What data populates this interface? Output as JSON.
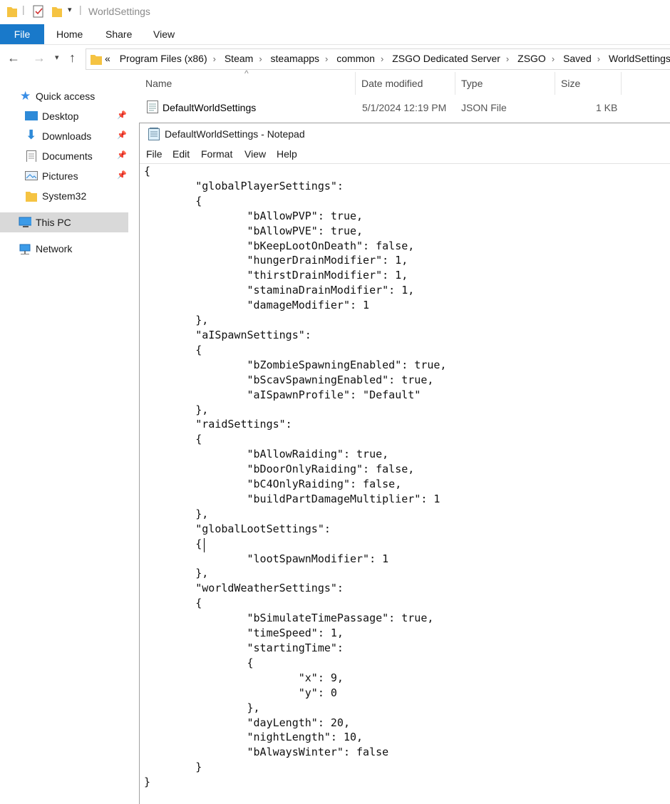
{
  "window": {
    "title": "WorldSettings"
  },
  "ribbon": {
    "tabs": [
      "File",
      "Home",
      "Share",
      "View"
    ]
  },
  "address": {
    "overflow": "«",
    "crumbs": [
      "Program Files (x86)",
      "Steam",
      "steamapps",
      "common",
      "ZSGO Dedicated Server",
      "ZSGO",
      "Saved",
      "WorldSettings"
    ]
  },
  "nav": {
    "items": [
      {
        "label": "Quick access",
        "icon": "star-icon"
      },
      {
        "label": "Desktop",
        "icon": "desktop-icon",
        "pinned": true
      },
      {
        "label": "Downloads",
        "icon": "download-icon",
        "pinned": true
      },
      {
        "label": "Documents",
        "icon": "document-icon",
        "pinned": true
      },
      {
        "label": "Pictures",
        "icon": "picture-icon",
        "pinned": true
      },
      {
        "label": "System32",
        "icon": "folder-icon"
      },
      {
        "label": "This PC",
        "icon": "computer-icon"
      },
      {
        "label": "Network",
        "icon": "network-icon"
      }
    ]
  },
  "columns": {
    "name": "Name",
    "date": "Date modified",
    "type": "Type",
    "size": "Size"
  },
  "file": {
    "name": "DefaultWorldSettings",
    "date": "5/1/2024 12:19 PM",
    "type": "JSON File",
    "size": "1 KB"
  },
  "notepad": {
    "title": "DefaultWorldSettings - Notepad",
    "menu": [
      "File",
      "Edit",
      "Format",
      "View",
      "Help"
    ],
    "content": "{\n\t\"globalPlayerSettings\":\n\t{\n\t\t\"bAllowPVP\": true,\n\t\t\"bAllowPVE\": true,\n\t\t\"bKeepLootOnDeath\": false,\n\t\t\"hungerDrainModifier\": 1,\n\t\t\"thirstDrainModifier\": 1,\n\t\t\"staminaDrainModifier\": 1,\n\t\t\"damageModifier\": 1\n\t},\n\t\"aISpawnSettings\":\n\t{\n\t\t\"bZombieSpawningEnabled\": true,\n\t\t\"bScavSpawningEnabled\": true,\n\t\t\"aISpawnProfile\": \"Default\"\n\t},\n\t\"raidSettings\":\n\t{\n\t\t\"bAllowRaiding\": true,\n\t\t\"bDoorOnlyRaiding\": false,\n\t\t\"bC4OnlyRaiding\": false,\n\t\t\"buildPartDamageMultiplier\": 1\n\t},\n\t\"globalLootSettings\":\n\t{\n\t\t\"lootSpawnModifier\": 1\n\t},\n\t\"worldWeatherSettings\":\n\t{\n\t\t\"bSimulateTimePassage\": true,\n\t\t\"timeSpeed\": 1,\n\t\t\"startingTime\":\n\t\t{\n\t\t\t\"x\": 9,\n\t\t\t\"y\": 0\n\t\t},\n\t\t\"dayLength\": 20,\n\t\t\"nightLength\": 10,\n\t\t\"bAlwaysWinter\": false\n\t}\n}"
  },
  "colors": {
    "accent": "#1979ca",
    "folder": "#f5c342",
    "selected": "#d9d9d9"
  }
}
